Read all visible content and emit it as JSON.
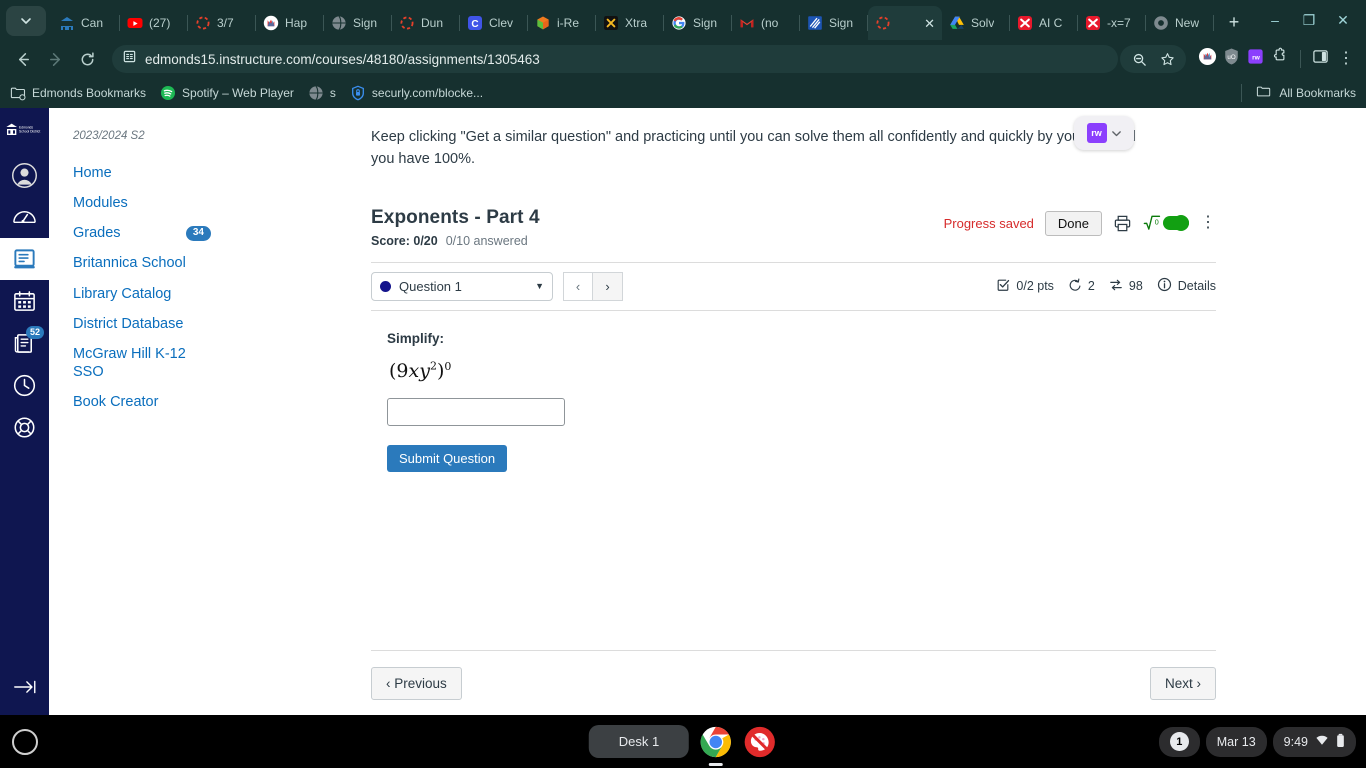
{
  "browser": {
    "tabs": [
      {
        "label": "Can",
        "icon": "canvas-icon"
      },
      {
        "label": "(27)",
        "icon": "youtube-icon"
      },
      {
        "label": "3/7",
        "icon": "loading-icon"
      },
      {
        "label": "Hap",
        "icon": "nearpod-icon"
      },
      {
        "label": "Sign",
        "icon": "globe-icon"
      },
      {
        "label": "Dun",
        "icon": "loading-icon"
      },
      {
        "label": "Clev",
        "icon": "clever-icon"
      },
      {
        "label": "i-Re",
        "icon": "iready-icon"
      },
      {
        "label": "Xtra",
        "icon": "xtramath-icon"
      },
      {
        "label": "Sign",
        "icon": "google-icon"
      },
      {
        "label": "(no",
        "icon": "gmail-icon"
      },
      {
        "label": "Sign",
        "icon": "bluebook-icon"
      },
      {
        "label": "",
        "icon": "loading-icon",
        "active": true
      },
      {
        "label": "Solv",
        "icon": "drive-icon"
      },
      {
        "label": "AI C",
        "icon": "mathway-icon"
      },
      {
        "label": "-x=7",
        "icon": "mathway-icon"
      },
      {
        "label": "New",
        "icon": "chrome-icon"
      }
    ],
    "tab_menu_icon": "chevron-down-icon",
    "new_tab_label": "+",
    "window_minimize": "–",
    "window_maximize": "❐",
    "window_close": "✕",
    "back_icon": "arrow-left-icon",
    "forward_icon": "arrow-right-icon",
    "reload_icon": "reload-icon",
    "url": "edmonds15.instructure.com/courses/48180/assignments/1305463",
    "site_icon": "page-info-icon",
    "zoom_out_icon": "zoom-out-icon",
    "bookmark_star_icon": "star-icon",
    "extensions": [
      "nearpod-ext-icon",
      "ublock-ext-icon",
      "readwrite-ext-icon",
      "extensions-puzzle-icon"
    ],
    "side_panel_icon": "side-panel-icon",
    "chrome_menu_icon": "kebab-menu-icon",
    "bookmarks": [
      {
        "label": "Edmonds Bookmarks",
        "icon": "folder-settings-icon"
      },
      {
        "label": "Spotify – Web Player",
        "icon": "spotify-icon"
      },
      {
        "label": "s",
        "icon": "globe-icon"
      },
      {
        "label": "securly.com/blocke...",
        "icon": "securly-shield-icon"
      }
    ],
    "all_bookmarks_label": "All Bookmarks",
    "all_bookmarks_icon": "folder-icon"
  },
  "canvas_global": {
    "logo_alt": "Edmonds School District",
    "items": [
      {
        "name": "account",
        "icon": "account-icon",
        "badge": null
      },
      {
        "name": "dashboard",
        "icon": "dashboard-icon",
        "badge": null
      },
      {
        "name": "courses",
        "icon": "courses-book-icon",
        "badge": null,
        "active": true
      },
      {
        "name": "calendar",
        "icon": "calendar-icon",
        "badge": null
      },
      {
        "name": "inbox",
        "icon": "inbox-icon",
        "badge": "52"
      },
      {
        "name": "history",
        "icon": "clock-icon",
        "badge": null
      },
      {
        "name": "help",
        "icon": "help-lifepreserver-icon",
        "badge": null
      }
    ],
    "collapse_icon": "arrow-right-bar-icon"
  },
  "course_nav": {
    "term": "2023/2024 S2",
    "items": [
      {
        "label": "Home",
        "badge": null
      },
      {
        "label": "Modules",
        "badge": null
      },
      {
        "label": "Grades",
        "badge": "34"
      },
      {
        "label": "Britannica School",
        "badge": null
      },
      {
        "label": "Library Catalog",
        "badge": null
      },
      {
        "label": "District Database",
        "badge": null
      },
      {
        "label": "McGraw Hill K-12 SSO",
        "badge": null
      },
      {
        "label": "Book Creator",
        "badge": null
      }
    ]
  },
  "main": {
    "intro": "Keep clicking \"Get a similar question\" and practicing until you can solve them all confidently and quickly by yourself and you have 100%.",
    "readwrite_widget": {
      "chip_label": "rw",
      "caret_icon": "chevron-down-icon"
    },
    "assignment_title": "Exponents - Part 4",
    "score_label": "Score: 0/20",
    "answered_label": "0/10 answered",
    "progress_saved": "Progress saved",
    "done_label": "Done",
    "print_icon": "printer-icon",
    "math_toggle_icon": "square-root-icon",
    "more_icon": "kebab-menu-icon",
    "question_select": "Question 1",
    "prev_q_icon": "chevron-left-icon",
    "next_q_icon": "chevron-right-icon",
    "meta": {
      "points_icon": "checkbox-icon",
      "points": "0/2 pts",
      "attempts_icon": "undo-icon",
      "attempts": "2",
      "similar_icon": "shuffle-icon",
      "similar": "98",
      "details_icon": "info-icon",
      "details": "Details"
    },
    "question": {
      "prompt": "Simplify:",
      "expression_base": "(9xy²)",
      "expression_exponent": "0",
      "answer_value": "",
      "answer_placeholder": "",
      "submit_label": "Submit Question"
    },
    "previous_label": "‹ Previous",
    "next_label": "Next ›"
  },
  "shelf": {
    "launcher_icon": "launcher-icon",
    "desk_label": "Desk 1",
    "apps": [
      {
        "name": "chrome-app-icon",
        "running": true
      },
      {
        "name": "paint-blocked-app-icon",
        "running": false
      }
    ],
    "tray_badge": "1",
    "date": "Mar 13",
    "time": "9:49",
    "wifi_icon": "wifi-icon",
    "battery_icon": "battery-icon"
  },
  "colors": {
    "chrome_bg": "#16302f",
    "canvas_nav": "#0f1650",
    "link_blue": "#0a6ebd",
    "accent_blue": "#2b7abc",
    "alert_red": "#d62b2b",
    "toggle_green": "#12a012"
  }
}
